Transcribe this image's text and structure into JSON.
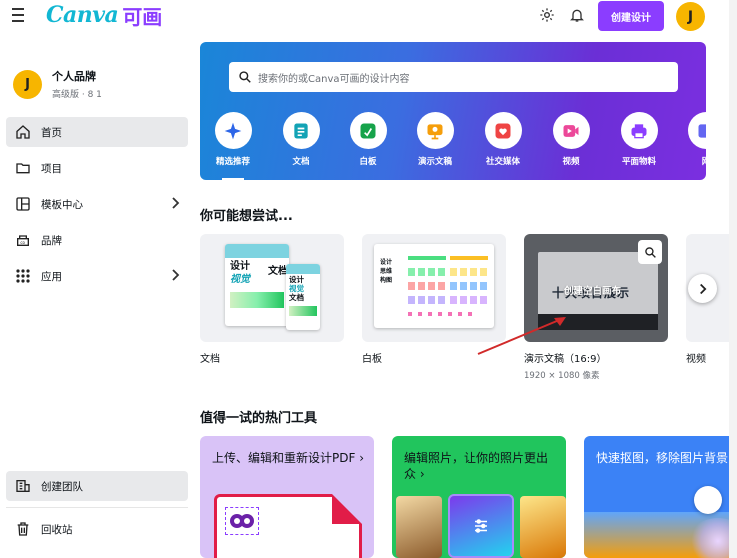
{
  "header": {
    "logo_brand": "Canva",
    "logo_cn": "可画",
    "create_button": "创建设计",
    "avatar_letter": "J"
  },
  "sidebar": {
    "profile": {
      "avatar_letter": "J",
      "name": "个人品牌",
      "plan": "高级版 · 8 1"
    },
    "items": [
      {
        "label": "首页",
        "icon": "home-icon"
      },
      {
        "label": "项目",
        "icon": "folder-icon"
      },
      {
        "label": "模板中心",
        "icon": "template-icon"
      },
      {
        "label": "品牌",
        "icon": "brand-icon"
      },
      {
        "label": "应用",
        "icon": "apps-icon"
      }
    ],
    "bottom_items": [
      {
        "label": "创建团队",
        "icon": "team-icon"
      },
      {
        "label": "回收站",
        "icon": "trash-icon"
      }
    ]
  },
  "hero": {
    "search_placeholder": "搜索你的或Canva可画的设计内容",
    "categories": [
      {
        "label": "精选推荐",
        "icon": "sparkle-icon",
        "color": "#2d66e8"
      },
      {
        "label": "文档",
        "icon": "doc-icon",
        "color": "#13a3b5"
      },
      {
        "label": "白板",
        "icon": "whiteboard-icon",
        "color": "#16a34a"
      },
      {
        "label": "演示文稿",
        "icon": "presentation-icon",
        "color": "#f59e0b"
      },
      {
        "label": "社交媒体",
        "icon": "heart-icon",
        "color": "#ef4444"
      },
      {
        "label": "视频",
        "icon": "video-icon",
        "color": "#ec4899"
      },
      {
        "label": "平面物料",
        "icon": "print-icon",
        "color": "#8b3dff"
      },
      {
        "label": "网",
        "icon": "web-icon",
        "color": "#6366f1"
      }
    ]
  },
  "suggestions": {
    "title": "你可能想尝试...",
    "cards": [
      {
        "label": "文档",
        "sub": ""
      },
      {
        "label": "白板",
        "sub": ""
      },
      {
        "label": "演示文稿（16:9）",
        "sub": "1920 × 1080 像素",
        "overlay": "创建空白画布",
        "preview_text": "十大项目展示"
      },
      {
        "label": "视频",
        "sub": ""
      }
    ]
  },
  "tools": {
    "title": "值得一试的热门工具",
    "items": [
      {
        "label": "上传、编辑和重新设计PDF ›",
        "bg": "#d9c3f7"
      },
      {
        "label": "编辑照片，让你的照片更出众 ›",
        "bg": "#21c55d"
      },
      {
        "label": "快速抠图，移除图片背景",
        "bg": "#3b82f6"
      }
    ]
  },
  "doc_preview": {
    "line1": "设计",
    "line2": "视觉",
    "line3": "文档",
    "small1": "设计",
    "small2": "视觉",
    "small3": "文档"
  },
  "whiteboard_preview": {
    "title1": "设计",
    "title2": "思维",
    "title3": "构图"
  }
}
